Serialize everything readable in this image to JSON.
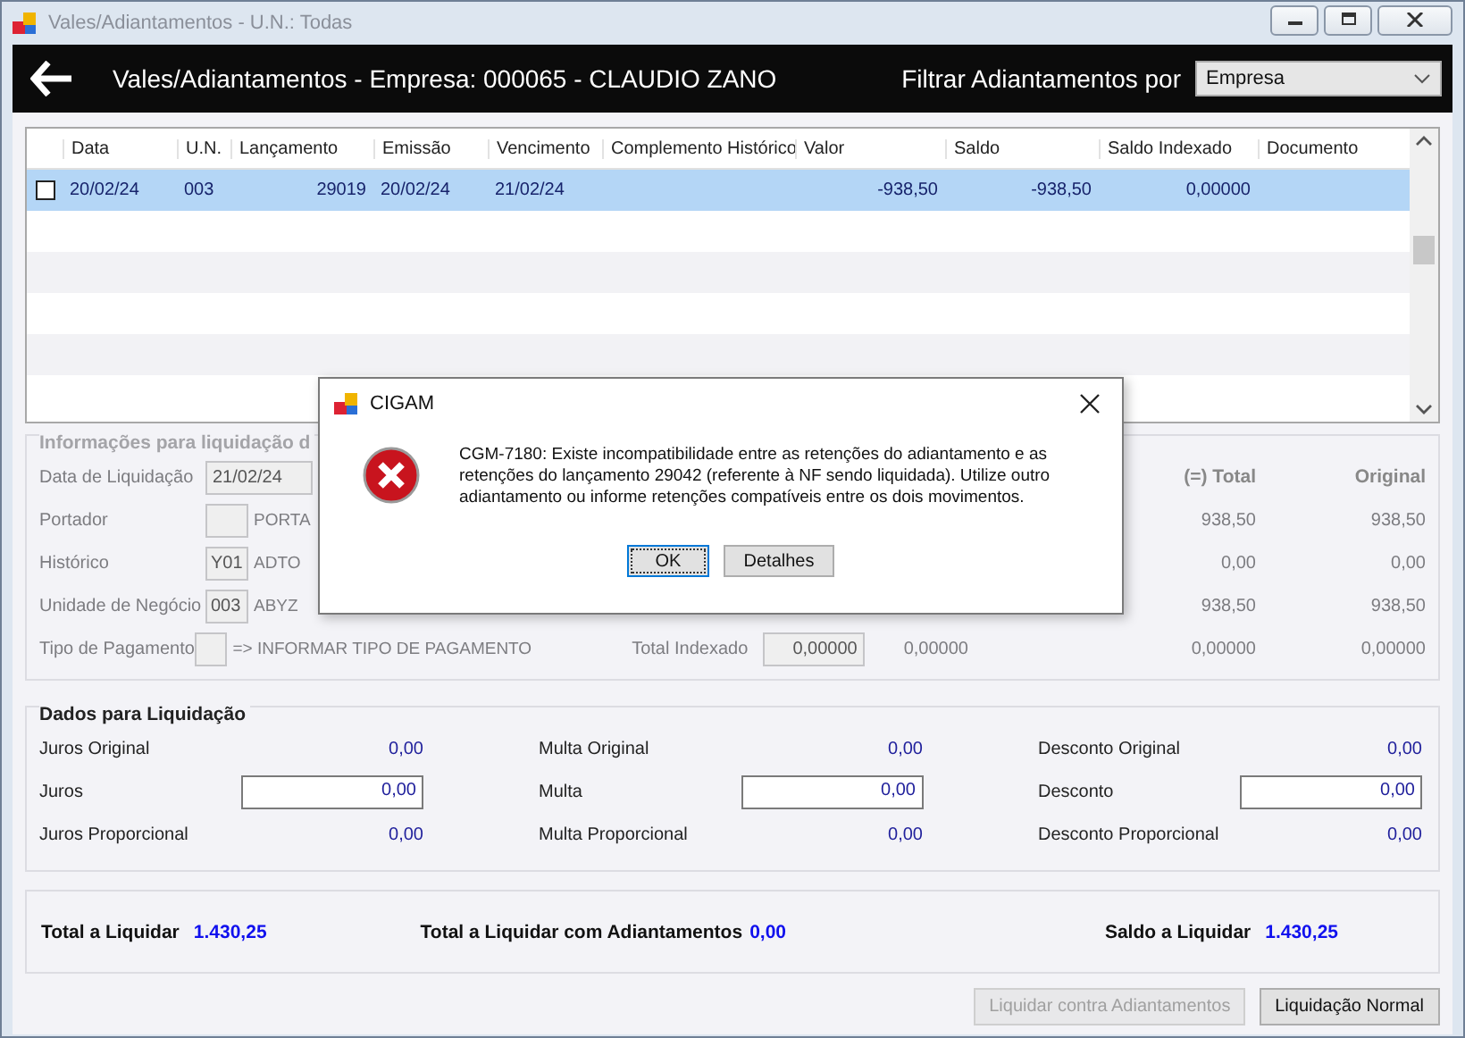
{
  "window": {
    "title": "Vales/Adiantamentos - U.N.: Todas"
  },
  "header": {
    "title": "Vales/Adiantamentos - Empresa: 000065 - CLAUDIO ZANO",
    "filter_label": "Filtrar Adiantamentos por",
    "filter_value": "Empresa"
  },
  "table": {
    "columns": [
      "Data",
      "U.N.",
      "Lançamento",
      "Emissão",
      "Vencimento",
      "Complemento Histórico",
      "Valor",
      "Saldo",
      "Saldo Indexado",
      "Documento"
    ],
    "rows": [
      {
        "checked": false,
        "selected": true,
        "cells": [
          "20/02/24",
          "003",
          "29019",
          "20/02/24",
          "21/02/24",
          "",
          "-938,50",
          "-938,50",
          "0,00000",
          ""
        ]
      }
    ]
  },
  "liquidacao_info": {
    "title": "Informações para liquidação d",
    "fields": [
      {
        "label": "Data de Liquidação",
        "kind": "date",
        "value": "21/02/24"
      },
      {
        "label": "Portador",
        "kind": "code",
        "text": "PORTA"
      },
      {
        "label": "Histórico",
        "kind": "code",
        "value": "Y01",
        "text": "ADTO"
      },
      {
        "label": "Unidade de Negócio",
        "kind": "code",
        "value": "003",
        "text": "ABYZ"
      },
      {
        "label": "Tipo de Pagamento",
        "kind": "code",
        "text": "=> INFORMAR TIPO DE PAGAMENTO"
      }
    ],
    "totals_header": [
      "(=) Total",
      "Original"
    ],
    "totals_rows": [
      [
        "938,50",
        "938,50"
      ],
      [
        "0,00",
        "0,00"
      ],
      [
        "938,50",
        "938,50"
      ]
    ],
    "indexado": {
      "label": "Total Indexado",
      "field": "0,00000",
      "values": [
        "0,00000",
        "0,00000",
        "0,00000"
      ]
    }
  },
  "dados_liquidacao": {
    "title": "Dados para Liquidação",
    "columns": [
      [
        {
          "label": "Juros Original",
          "kind": "value",
          "value": "0,00"
        },
        {
          "label": "Juros",
          "kind": "input",
          "value": "0,00"
        },
        {
          "label": "Juros Proporcional",
          "kind": "value",
          "value": "0,00"
        }
      ],
      [
        {
          "label": "Multa Original",
          "kind": "value",
          "value": "0,00"
        },
        {
          "label": "Multa",
          "kind": "input",
          "value": "0,00"
        },
        {
          "label": "Multa Proporcional",
          "kind": "value",
          "value": "0,00"
        }
      ],
      [
        {
          "label": "Desconto Original",
          "kind": "value",
          "value": "0,00"
        },
        {
          "label": "Desconto",
          "kind": "input",
          "value": "0,00"
        },
        {
          "label": "Desconto Proporcional",
          "kind": "value",
          "value": "0,00"
        }
      ]
    ]
  },
  "totals": [
    {
      "label": "Total a Liquidar",
      "value": "1.430,25"
    },
    {
      "label": "Total a Liquidar com Adiantamentos",
      "value": "0,00"
    },
    {
      "label": "Saldo a Liquidar",
      "value": "1.430,25"
    }
  ],
  "buttons": [
    {
      "label": "Liquidar contra Adiantamentos",
      "disabled": true
    },
    {
      "label": "Liquidação Normal",
      "disabled": false
    }
  ],
  "dialog": {
    "title": "CIGAM",
    "message": "CGM-7180: Existe incompatibilidade entre as retenções do adiantamento e as retenções do lançamento 29042 (referente  à NF sendo liquidada). Utilize outro adiantamento ou informe retenções compatíveis entre os dois movimentos.",
    "buttons": [
      {
        "label": "OK",
        "focused": true
      },
      {
        "label": "Detalhes",
        "focused": false
      }
    ]
  }
}
